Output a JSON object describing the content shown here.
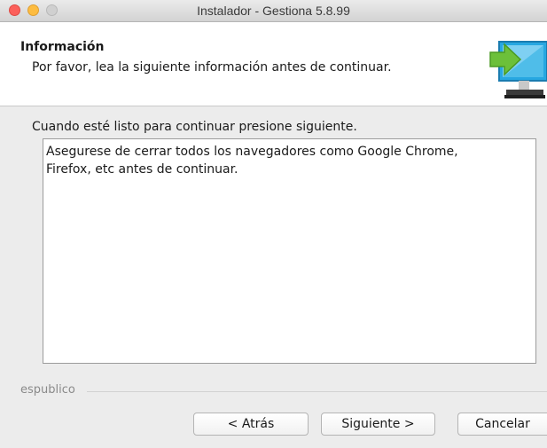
{
  "window": {
    "title": "Instalador - Gestiona 5.8.99"
  },
  "header": {
    "title": "Información",
    "subtitle": "Por favor, lea la siguiente información antes de continuar.",
    "icon": "computer-arrow-icon"
  },
  "main": {
    "instructions": "Cuando esté listo para continuar presione siguiente.",
    "info_text": "Asegurese de cerrar todos los navegadores como Google Chrome,\nFirefox, etc antes de continuar."
  },
  "footer": {
    "vendor": "espublico",
    "back_label": "< Atrás",
    "next_label": "Siguiente >",
    "cancel_label": "Cancelar"
  },
  "colors": {
    "close": "#fc605b",
    "minimize": "#fdbc40",
    "maximize": "#d0d0d0",
    "icon_arrow": "#6cc03a",
    "icon_screen": "#27a7e1"
  }
}
